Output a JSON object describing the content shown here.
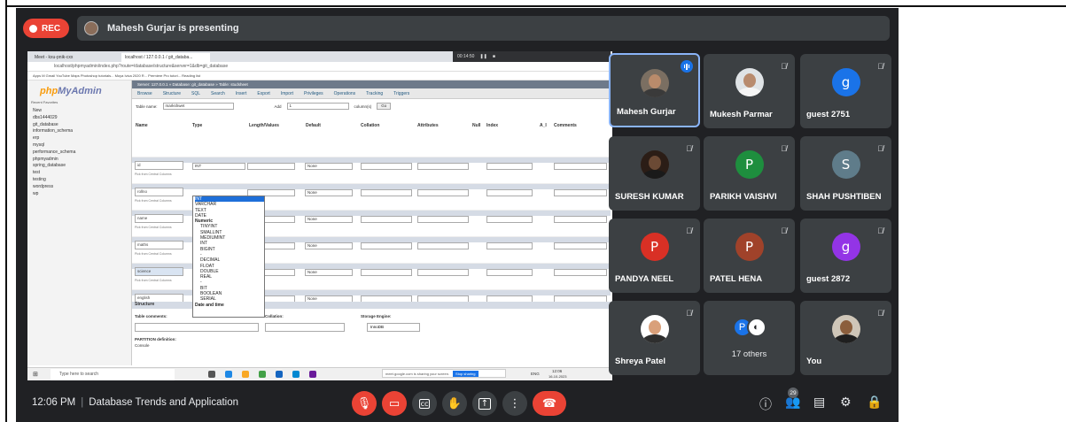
{
  "top_bar": {
    "rec_label": "REC",
    "presenter_text": "Mahesh Gurjar is presenting"
  },
  "shared_screen": {
    "browser_tabs": [
      "Meet - kxu-pnik-cxx",
      "localhost / 127.0.0.1 / git_databa..."
    ],
    "share_timer": "00:14:50",
    "address": "localhost/phpmyadmin/index.php?route=/database/structure&server=1&db=git_database",
    "bookmarks": "Apps  M Gmail  YouTube  Maps  Photoshop tutorials...  Moya Ivica 2020 R...  Premiere Pro tutori...  Reading list",
    "pma_logo_a": "php",
    "pma_logo_b": "MyAdmin",
    "pma_recent": "Recent  Favorites",
    "tree": [
      "New",
      "dbs1444029",
      "git_database",
      "information_schema",
      "erp",
      "mysql",
      "performance_schema",
      "phpmyadmin",
      "spring_database",
      "test",
      "testing",
      "wordpress",
      "wp"
    ],
    "crumb": "Server: 127.0.0.1 » Database: git_database » Table: studsheet",
    "menu": [
      "Browse",
      "Structure",
      "SQL",
      "Search",
      "Insert",
      "Export",
      "Import",
      "Privileges",
      "Operations",
      "Tracking",
      "Triggers"
    ],
    "table_name_label": "Table name:",
    "table_name_value": "markshwet",
    "add_label": "Add",
    "add_value": "1",
    "columns_label": "column(s)",
    "go_label": "Go",
    "col_headers": [
      "Name",
      "Type",
      "Length/Values",
      "Default",
      "Collation",
      "Attributes",
      "Null",
      "Index",
      "A_I",
      "Comments"
    ],
    "fields": [
      {
        "name": "id",
        "type": "INT",
        "default": "None"
      },
      {
        "name": "rollno",
        "type": "INT",
        "default": "None"
      },
      {
        "name": "name",
        "type": "INT",
        "default": "None"
      },
      {
        "name": "maths",
        "type": "INT",
        "default": "None"
      },
      {
        "name": "science",
        "type": "INT",
        "default": "None"
      },
      {
        "name": "english",
        "type": "INT",
        "default": "None"
      }
    ],
    "pick_text": "Pick from Central Columns",
    "type_dropdown": [
      "INT",
      "VARCHAR",
      "TEXT",
      "DATE",
      "Numeric",
      "TINYINT",
      "SMALLINT",
      "MEDIUMINT",
      "INT",
      "BIGINT",
      "-",
      "DECIMAL",
      "FLOAT",
      "DOUBLE",
      "REAL",
      "-",
      "BIT",
      "BOOLEAN",
      "SERIAL",
      "Date and time"
    ],
    "structure_label": "Structure",
    "table_comments_label": "Table comments:",
    "collation_label": "Collation:",
    "storage_label": "Storage Engine:",
    "storage_value": "InnoDB",
    "partition_label": "PARTITION definition:",
    "console_label": "Console",
    "taskbar_search": "Type here to search",
    "sharing_text": "meet.google.com is sharing your screen.",
    "stop_sharing": "Stop sharing",
    "taskbar_time": "12:06",
    "taskbar_date": "16-10-2023",
    "taskbar_lang": "ENG"
  },
  "participants": [
    {
      "name": "Mahesh Gurjar",
      "type": "photo",
      "speaking": true
    },
    {
      "name": "Mukesh Parmar",
      "type": "photo",
      "muted": true
    },
    {
      "name": "guest 2751",
      "type": "letter",
      "letter": "g",
      "color": "#1a73e8",
      "muted": true
    },
    {
      "name": "SURESH KUMAR",
      "type": "photo",
      "muted": true
    },
    {
      "name": "PARIKH VAISHVI",
      "type": "letter",
      "letter": "P",
      "color": "#1e8e3e",
      "muted": true
    },
    {
      "name": "SHAH PUSHTIBEN",
      "type": "letter",
      "letter": "S",
      "color": "#5f7c8a",
      "muted": true
    },
    {
      "name": "PANDYA NEEL",
      "type": "letter",
      "letter": "P",
      "color": "#d93025",
      "muted": true
    },
    {
      "name": "PATEL HENA",
      "type": "letter",
      "letter": "P",
      "color": "#a0422a",
      "muted": true
    },
    {
      "name": "guest 2872",
      "type": "letter",
      "letter": "g",
      "color": "#9334e6",
      "muted": true
    },
    {
      "name": "Shreya Patel",
      "type": "photo",
      "muted": true
    },
    {
      "name": "17 others",
      "type": "others"
    },
    {
      "name": "You",
      "type": "photo",
      "muted": true
    }
  ],
  "bottom_bar": {
    "time": "12:06 PM",
    "meeting_title": "Database Trends and Application",
    "participant_count": "29"
  },
  "colors": {
    "background": "#202124",
    "tile": "#3c4043",
    "accent": "#1a73e8",
    "danger": "#ea4335"
  },
  "icons": [
    "mic-off-icon",
    "camera-off-icon",
    "captions-icon",
    "raise-hand-icon",
    "present-icon",
    "more-options-icon",
    "end-call-icon",
    "info-icon",
    "people-icon",
    "chat-icon",
    "activities-icon",
    "host-controls-icon"
  ]
}
